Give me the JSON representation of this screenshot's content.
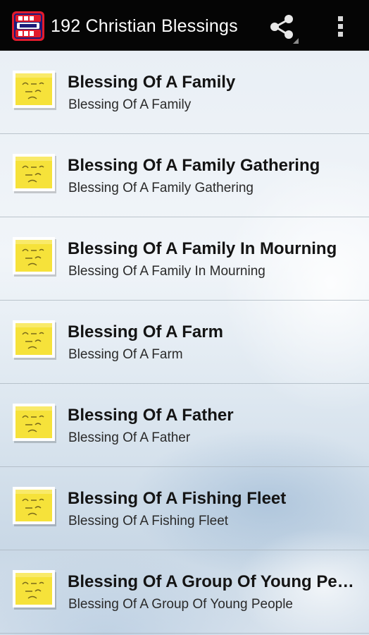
{
  "actionbar": {
    "title": "192 Christian Blessings",
    "app_icon": "god-bless-you-logo",
    "share_icon": "share-icon",
    "overflow_icon": "overflow-menu-icon"
  },
  "list": {
    "item_icon": "sticky-note-icon",
    "items": [
      {
        "title": "Blessing Of A Family",
        "subtitle": "Blessing Of A Family"
      },
      {
        "title": "Blessing Of A Family Gathering",
        "subtitle": "Blessing Of A Family Gathering"
      },
      {
        "title": "Blessing Of A Family In Mourning",
        "subtitle": "Blessing Of A Family In Mourning"
      },
      {
        "title": "Blessing Of A Farm",
        "subtitle": "Blessing Of A Farm"
      },
      {
        "title": "Blessing Of A Father",
        "subtitle": "Blessing Of A Father"
      },
      {
        "title": "Blessing Of A Fishing Fleet",
        "subtitle": "Blessing Of A Fishing Fleet"
      },
      {
        "title": "Blessing Of A Group Of Young People",
        "subtitle": "Blessing Of A Group Of Young People"
      }
    ]
  },
  "colors": {
    "actionbar_bg": "#050505",
    "title_text": "#ffffff",
    "item_title": "#141414",
    "item_subtitle": "#2a2a2a",
    "sticky_note": "#f6e23a"
  }
}
